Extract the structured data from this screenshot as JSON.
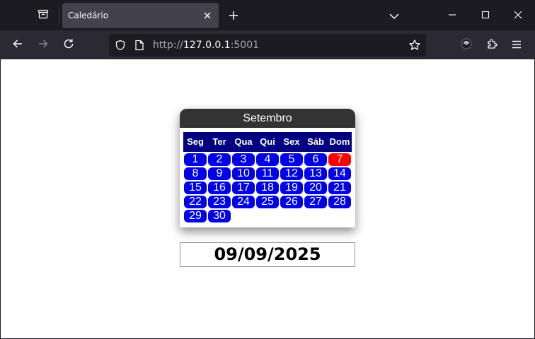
{
  "browser": {
    "tab": {
      "title": "Caledário"
    },
    "url": {
      "scheme": "http://",
      "host": "127.0.0.1",
      "port": ":5001"
    }
  },
  "calendar": {
    "month": "Setembro",
    "weekdays": [
      "Seg",
      "Ter",
      "Qua",
      "Qui",
      "Sex",
      "Sáb",
      "Dom"
    ],
    "days": [
      "1",
      "2",
      "3",
      "4",
      "5",
      "6",
      "7",
      "8",
      "9",
      "10",
      "11",
      "12",
      "13",
      "14",
      "15",
      "16",
      "17",
      "18",
      "19",
      "20",
      "21",
      "22",
      "23",
      "24",
      "25",
      "26",
      "27",
      "28",
      "29",
      "30"
    ],
    "highlight_color": "#ff0000",
    "day_color": "#0000e6",
    "header_row_color": "#000080"
  },
  "selected_date": "09/09/2025"
}
